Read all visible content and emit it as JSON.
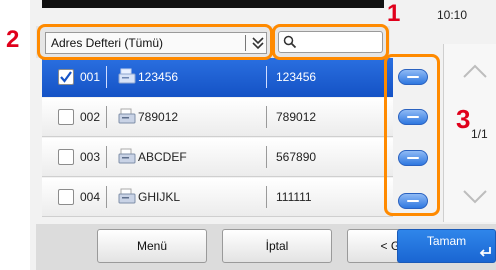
{
  "status": {
    "time": "10:10"
  },
  "callouts": [
    "1",
    "2",
    "3"
  ],
  "address_book": {
    "selected": "Adres Defteri (Tümü)"
  },
  "search": {
    "placeholder": ""
  },
  "rows": [
    {
      "number": "001",
      "name": "123456",
      "fax": "123456",
      "checked": true
    },
    {
      "number": "002",
      "name": "789012",
      "fax": "789012",
      "checked": false
    },
    {
      "number": "003",
      "name": "ABCDEF",
      "fax": "567890",
      "checked": false
    },
    {
      "number": "004",
      "name": "GHIJKL",
      "fax": "111111",
      "checked": false
    }
  ],
  "pagination": {
    "indicator": "1/1"
  },
  "buttons": {
    "menu": "Menü",
    "cancel": "İptal",
    "back": "< Geri",
    "ok": "Tamam"
  },
  "colors": {
    "accent": "#1a66d2",
    "selected_row": "#1553c6",
    "callout": "#e0001b",
    "highlight": "#ff8a00"
  },
  "icons": [
    "checkbox-checked-icon",
    "fax-icon",
    "search-icon",
    "chevron-double-down-icon",
    "detail-icon",
    "scroll-up-icon",
    "scroll-down-icon",
    "enter-arrow-icon"
  ]
}
